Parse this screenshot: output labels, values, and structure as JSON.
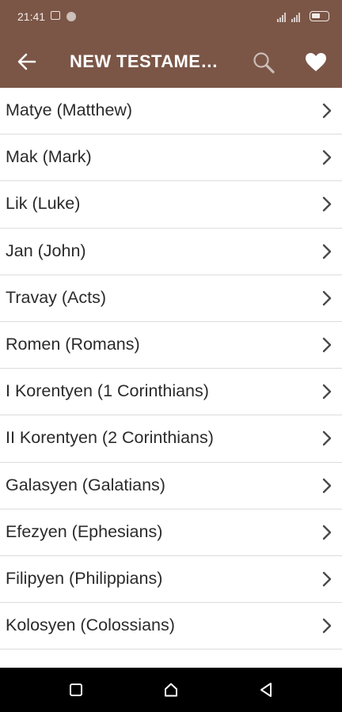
{
  "status_bar": {
    "time": "21:41"
  },
  "app_bar": {
    "title": "NEW TESTAME…",
    "back_icon": "arrow-left-icon",
    "search_icon": "search-icon",
    "favorite_icon": "heart-icon",
    "color": "#7b5647"
  },
  "books": [
    {
      "label": "Matye (Matthew)"
    },
    {
      "label": "Mak (Mark)"
    },
    {
      "label": "Lik (Luke)"
    },
    {
      "label": "Jan (John)"
    },
    {
      "label": "Travay (Acts)"
    },
    {
      "label": "Romen (Romans)"
    },
    {
      "label": "I Korentyen (1 Corinthians)"
    },
    {
      "label": "II Korentyen (2 Corinthians)"
    },
    {
      "label": "Galasyen (Galatians)"
    },
    {
      "label": "Efezyen (Ephesians)"
    },
    {
      "label": "Filipyen (Philippians)"
    },
    {
      "label": "Kolosyen (Colossians)"
    }
  ],
  "nav_bar": {
    "recents_icon": "square-icon",
    "home_icon": "home-icon",
    "back_icon": "triangle-back-icon"
  }
}
